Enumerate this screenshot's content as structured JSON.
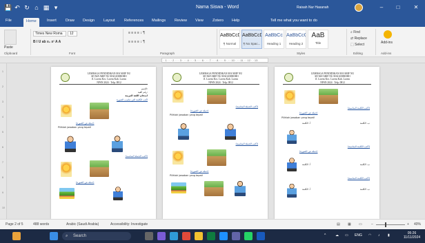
{
  "window": {
    "title": "Nama Siswa - Word",
    "user_name": "Raisah Nur Hasanah",
    "controls": [
      "–",
      "□",
      "✕"
    ]
  },
  "qat": [
    "💾",
    "↶",
    "↻",
    "⌂",
    "▦",
    "▾"
  ],
  "tabs": [
    "File",
    "Home",
    "Insert",
    "Draw",
    "Design",
    "Layout",
    "References",
    "Mailings",
    "Review",
    "View",
    "Zotero",
    "Help"
  ],
  "tell_me": "Tell me what you want to do",
  "ribbon": {
    "clipboard": {
      "paste_label": "Paste",
      "group_label": "Clipboard"
    },
    "font": {
      "font_name": "Times New Roma",
      "font_size": "12",
      "group_label": "Font",
      "format_buttons": "B  I  U  ab  x₂  x²  A  A"
    },
    "paragraph": {
      "group_label": "Paragraph",
      "buttons": "≡ ≡ ≡ ≡  ↕  ¶"
    },
    "styles": {
      "group_label": "Styles",
      "items": [
        {
          "sample": "AaBbCcDc",
          "name": "¶ Normal"
        },
        {
          "sample": "AaBbCcDc",
          "name": "¶ No Spac..."
        },
        {
          "sample": "AaBbCc",
          "name": "Heading 1"
        },
        {
          "sample": "AaBbCcC",
          "name": "Heading 2"
        },
        {
          "sample": "AaB",
          "name": "Title"
        }
      ]
    },
    "editing": {
      "find": "Find",
      "replace": "Replace",
      "select": "Select",
      "group_label": "Editing"
    },
    "addins": {
      "label": "Add-ins",
      "group_label": "Add-ins"
    }
  },
  "ruler": {
    "scale": "· 1 · · · 2 · · · 3 · · · 4 · · · 5 · · · 6 · · · 7 · · · 8 · · · 9 · · · 10 · · · 11 · · 12 · · 13"
  },
  "vruler_ticks": [
    "1",
    "2",
    "3",
    "4",
    "5",
    "6",
    "7",
    "8",
    "9",
    "10"
  ],
  "pages": [
    {
      "school": "LEMBAGA PENDIDIKAN MA'ARIF NU\nSD MA'ARIF NU MAGUMBOHO\nJl. Lorem Kec. Lorem Kab. Lorem\nNPSN 2024 · Telp. 0812",
      "lines": [
        "الإسم:",
        "رقم القيد:",
        "امتحان اللغة العربية",
        "اكتب الكلمة التي تناسب الصورة",
        "(جملة عن الصورة)",
        "Pilihlah jawaban yang tepat!",
        "(اكتب الجملة المناسبة)",
        "(جملة عن الصورة)"
      ]
    },
    {
      "school": "LEMBAGA PENDIDIKAN MA'ARIF NU\nSD MA'ARIF NU MAGUMBOHO\nJl. Lorem Kec. Lorem Kab. Lorem\nNPSN 2024 · Telp. 0812",
      "lines": [
        "(اكتب الجملة المناسبة)",
        "(جملة عن الصورة)",
        "Pilihlah jawaban yang tepat!",
        "(اكتب الجملة المناسبة)",
        "(جملة عن الصورة)",
        "Pilihlah jawaban yang tepat!"
      ]
    },
    {
      "school": "LEMBAGA PENDIDIKAN MA'ARIF NU\nSD MA'ARIF NU MAGUMBOHO\nJl. Lorem Kec. Lorem Kab. Lorem\nNPSN 2024 · Telp. 0812",
      "lines": [
        "(اكتب الكلمة المناسبة)",
        "(جملة عن الصورة)",
        "Pilihlah jawaban yang tepat!",
        "أ. الكلمة",
        "ب. الكلمة",
        "(اكتب الكلمة المناسبة)",
        "(جملة عن الصورة)",
        "أ. الكلمة",
        "ب. الكلمة",
        "(اكتب الكلمة المناسبة)",
        "أ. الكلمة",
        "ب. الكلمة"
      ]
    }
  ],
  "status": {
    "page": "Page 2 of 5",
    "words": "488 words",
    "language": "Arabic (Saudi Arabia)",
    "accessibility": "Accessibility: Investigate",
    "zoom": "40%"
  },
  "taskbar": {
    "search": "Search",
    "lang": "ENG",
    "time": "05:26",
    "date": "11/11/2024"
  }
}
